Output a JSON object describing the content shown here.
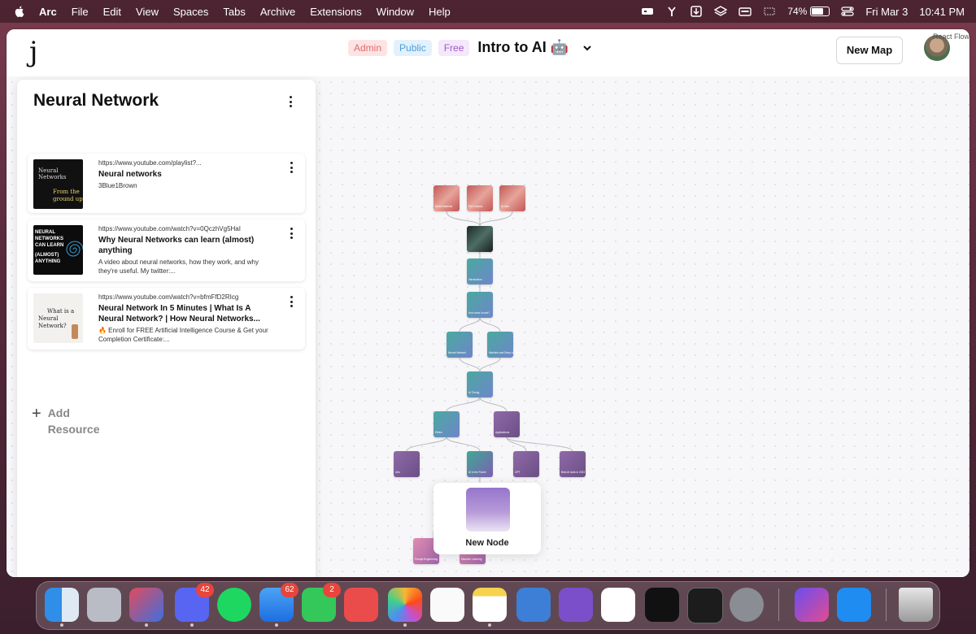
{
  "menubar": {
    "app": "Arc",
    "items": [
      "File",
      "Edit",
      "View",
      "Spaces",
      "Tabs",
      "Archive",
      "Extensions",
      "Window",
      "Help"
    ],
    "battery_pct": "74%",
    "battery_level": 0.74,
    "date": "Fri Mar 3",
    "time": "10:41 PM"
  },
  "app": {
    "logo": "j",
    "tags": {
      "admin": "Admin",
      "public": "Public",
      "free": "Free"
    },
    "map_title": "Intro to AI 🤖",
    "new_map_label": "New Map",
    "react_flow_label": "React Flow"
  },
  "panel": {
    "title": "Neural Network",
    "resources": [
      {
        "url": "https://www.youtube.com/playlist?...",
        "title": "Neural networks",
        "desc": "3Blue1Brown",
        "thumb_text_a": "Neural Networks",
        "thumb_text_b": "From the ground up"
      },
      {
        "url": "https://www.youtube.com/watch?v=0QczhVg5HaI",
        "title": "Why Neural Networks can learn (almost) anything",
        "desc": "A video about neural networks, how they work, and why they're useful. My twitter:...",
        "thumb_text_a": "NEURAL NETWORKS CAN LEARN",
        "thumb_text_b": "(ALMOST) ANYTHING"
      },
      {
        "url": "https://www.youtube.com/watch?v=bfmFfD2RIcg",
        "title": "Neural Network In 5 Minutes | What Is A Neural Network? | How Neural Networks...",
        "desc": "🔥 Enroll for FREE Artificial Intelligence Course & Get your Completion Certificate:...",
        "thumb_text_a": "What is a",
        "thumb_text_b": "Neural Network?"
      }
    ],
    "add_resource_label": "Add Resource"
  },
  "flow": {
    "nodes": [
      {
        "label": "About Machine"
      },
      {
        "label": "Pal Controls"
      },
      {
        "label": "AI Intro"
      },
      {
        "label": ""
      },
      {
        "label": "Introduction"
      },
      {
        "label": "How does it work?"
      },
      {
        "label": "Neural Network"
      },
      {
        "label": "Machine and Deep Learning"
      },
      {
        "label": "AI Timing"
      },
      {
        "label": "Ethics"
      },
      {
        "label": "Applications"
      },
      {
        "label": "Arts"
      },
      {
        "label": "AI in the Future"
      },
      {
        "label": "GPT"
      },
      {
        "label": "Best AI tools in 2023"
      },
      {
        "label": "Prompt Engineering"
      },
      {
        "label": "Machine Learning"
      }
    ],
    "new_node_label": "New Node"
  },
  "dock": {
    "apps": [
      {
        "name": "finder-icon",
        "badge": ""
      },
      {
        "name": "launchpad-icon",
        "badge": ""
      },
      {
        "name": "arc-browser-icon",
        "badge": ""
      },
      {
        "name": "discord-icon",
        "badge": "42"
      },
      {
        "name": "spotify-icon",
        "badge": ""
      },
      {
        "name": "mail-icon",
        "badge": "62"
      },
      {
        "name": "messages-icon",
        "badge": "2"
      },
      {
        "name": "speech-bubble-icon",
        "badge": ""
      },
      {
        "name": "photos-icon",
        "badge": ""
      },
      {
        "name": "reminders-icon",
        "badge": ""
      },
      {
        "name": "notes-icon",
        "badge": ""
      },
      {
        "name": "preview-icon",
        "badge": ""
      },
      {
        "name": "github-desktop-icon",
        "badge": ""
      },
      {
        "name": "vscode-icon",
        "badge": ""
      },
      {
        "name": "activity-monitor-icon",
        "badge": ""
      },
      {
        "name": "terminal-icon",
        "badge": ""
      },
      {
        "name": "system-settings-icon",
        "badge": ""
      },
      {
        "name": "shortcuts-icon",
        "badge": ""
      },
      {
        "name": "app-store-icon",
        "badge": ""
      },
      {
        "name": "trash-icon",
        "badge": ""
      }
    ]
  }
}
